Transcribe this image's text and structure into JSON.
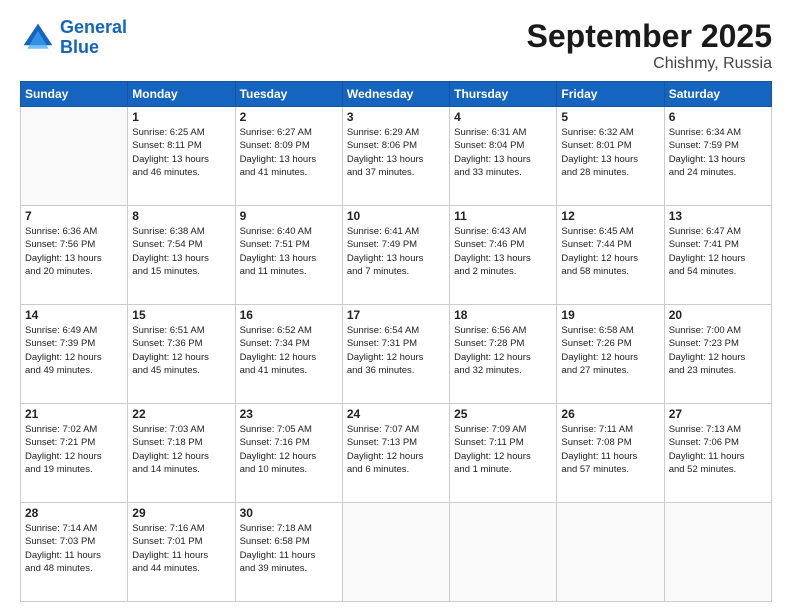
{
  "header": {
    "logo_line1": "General",
    "logo_line2": "Blue",
    "month": "September 2025",
    "location": "Chishmy, Russia"
  },
  "days_of_week": [
    "Sunday",
    "Monday",
    "Tuesday",
    "Wednesday",
    "Thursday",
    "Friday",
    "Saturday"
  ],
  "weeks": [
    [
      {
        "day": "",
        "info": ""
      },
      {
        "day": "1",
        "info": "Sunrise: 6:25 AM\nSunset: 8:11 PM\nDaylight: 13 hours\nand 46 minutes."
      },
      {
        "day": "2",
        "info": "Sunrise: 6:27 AM\nSunset: 8:09 PM\nDaylight: 13 hours\nand 41 minutes."
      },
      {
        "day": "3",
        "info": "Sunrise: 6:29 AM\nSunset: 8:06 PM\nDaylight: 13 hours\nand 37 minutes."
      },
      {
        "day": "4",
        "info": "Sunrise: 6:31 AM\nSunset: 8:04 PM\nDaylight: 13 hours\nand 33 minutes."
      },
      {
        "day": "5",
        "info": "Sunrise: 6:32 AM\nSunset: 8:01 PM\nDaylight: 13 hours\nand 28 minutes."
      },
      {
        "day": "6",
        "info": "Sunrise: 6:34 AM\nSunset: 7:59 PM\nDaylight: 13 hours\nand 24 minutes."
      }
    ],
    [
      {
        "day": "7",
        "info": "Sunrise: 6:36 AM\nSunset: 7:56 PM\nDaylight: 13 hours\nand 20 minutes."
      },
      {
        "day": "8",
        "info": "Sunrise: 6:38 AM\nSunset: 7:54 PM\nDaylight: 13 hours\nand 15 minutes."
      },
      {
        "day": "9",
        "info": "Sunrise: 6:40 AM\nSunset: 7:51 PM\nDaylight: 13 hours\nand 11 minutes."
      },
      {
        "day": "10",
        "info": "Sunrise: 6:41 AM\nSunset: 7:49 PM\nDaylight: 13 hours\nand 7 minutes."
      },
      {
        "day": "11",
        "info": "Sunrise: 6:43 AM\nSunset: 7:46 PM\nDaylight: 13 hours\nand 2 minutes."
      },
      {
        "day": "12",
        "info": "Sunrise: 6:45 AM\nSunset: 7:44 PM\nDaylight: 12 hours\nand 58 minutes."
      },
      {
        "day": "13",
        "info": "Sunrise: 6:47 AM\nSunset: 7:41 PM\nDaylight: 12 hours\nand 54 minutes."
      }
    ],
    [
      {
        "day": "14",
        "info": "Sunrise: 6:49 AM\nSunset: 7:39 PM\nDaylight: 12 hours\nand 49 minutes."
      },
      {
        "day": "15",
        "info": "Sunrise: 6:51 AM\nSunset: 7:36 PM\nDaylight: 12 hours\nand 45 minutes."
      },
      {
        "day": "16",
        "info": "Sunrise: 6:52 AM\nSunset: 7:34 PM\nDaylight: 12 hours\nand 41 minutes."
      },
      {
        "day": "17",
        "info": "Sunrise: 6:54 AM\nSunset: 7:31 PM\nDaylight: 12 hours\nand 36 minutes."
      },
      {
        "day": "18",
        "info": "Sunrise: 6:56 AM\nSunset: 7:28 PM\nDaylight: 12 hours\nand 32 minutes."
      },
      {
        "day": "19",
        "info": "Sunrise: 6:58 AM\nSunset: 7:26 PM\nDaylight: 12 hours\nand 27 minutes."
      },
      {
        "day": "20",
        "info": "Sunrise: 7:00 AM\nSunset: 7:23 PM\nDaylight: 12 hours\nand 23 minutes."
      }
    ],
    [
      {
        "day": "21",
        "info": "Sunrise: 7:02 AM\nSunset: 7:21 PM\nDaylight: 12 hours\nand 19 minutes."
      },
      {
        "day": "22",
        "info": "Sunrise: 7:03 AM\nSunset: 7:18 PM\nDaylight: 12 hours\nand 14 minutes."
      },
      {
        "day": "23",
        "info": "Sunrise: 7:05 AM\nSunset: 7:16 PM\nDaylight: 12 hours\nand 10 minutes."
      },
      {
        "day": "24",
        "info": "Sunrise: 7:07 AM\nSunset: 7:13 PM\nDaylight: 12 hours\nand 6 minutes."
      },
      {
        "day": "25",
        "info": "Sunrise: 7:09 AM\nSunset: 7:11 PM\nDaylight: 12 hours\nand 1 minute."
      },
      {
        "day": "26",
        "info": "Sunrise: 7:11 AM\nSunset: 7:08 PM\nDaylight: 11 hours\nand 57 minutes."
      },
      {
        "day": "27",
        "info": "Sunrise: 7:13 AM\nSunset: 7:06 PM\nDaylight: 11 hours\nand 52 minutes."
      }
    ],
    [
      {
        "day": "28",
        "info": "Sunrise: 7:14 AM\nSunset: 7:03 PM\nDaylight: 11 hours\nand 48 minutes."
      },
      {
        "day": "29",
        "info": "Sunrise: 7:16 AM\nSunset: 7:01 PM\nDaylight: 11 hours\nand 44 minutes."
      },
      {
        "day": "30",
        "info": "Sunrise: 7:18 AM\nSunset: 6:58 PM\nDaylight: 11 hours\nand 39 minutes."
      },
      {
        "day": "",
        "info": ""
      },
      {
        "day": "",
        "info": ""
      },
      {
        "day": "",
        "info": ""
      },
      {
        "day": "",
        "info": ""
      }
    ]
  ]
}
